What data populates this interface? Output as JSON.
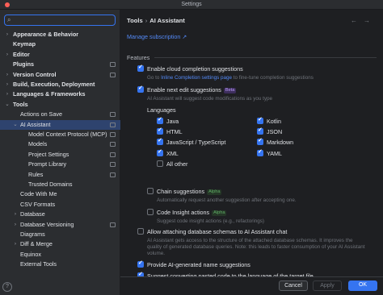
{
  "window": {
    "title": "Settings"
  },
  "sidebar": {
    "search_placeholder": "",
    "items": [
      {
        "label": "Appearance & Behavior",
        "chev": "›",
        "indent": 0,
        "bold": true
      },
      {
        "label": "Keymap",
        "chev": "",
        "indent": 0,
        "bold": true
      },
      {
        "label": "Editor",
        "chev": "›",
        "indent": 0,
        "bold": true
      },
      {
        "label": "Plugins",
        "chev": "",
        "indent": 0,
        "bold": true,
        "badge": true
      },
      {
        "label": "Version Control",
        "chev": "›",
        "indent": 0,
        "bold": true,
        "badge": true
      },
      {
        "label": "Build, Execution, Deployment",
        "chev": "›",
        "indent": 0,
        "bold": true
      },
      {
        "label": "Languages & Frameworks",
        "chev": "›",
        "indent": 0,
        "bold": true
      },
      {
        "label": "Tools",
        "chev": "⌄",
        "indent": 0,
        "bold": true
      },
      {
        "label": "Actions on Save",
        "chev": "",
        "indent": 1,
        "badge": true
      },
      {
        "label": "AI Assistant",
        "chev": "⌄",
        "indent": 1,
        "selected": true,
        "badge": true
      },
      {
        "label": "Model Context Protocol (MCP)",
        "chev": "",
        "indent": 2,
        "badge": true
      },
      {
        "label": "Models",
        "chev": "",
        "indent": 2,
        "badge": true
      },
      {
        "label": "Project Settings",
        "chev": "",
        "indent": 2,
        "badge": true
      },
      {
        "label": "Prompt Library",
        "chev": "",
        "indent": 2,
        "badge": true
      },
      {
        "label": "Rules",
        "chev": "",
        "indent": 2,
        "badge": true
      },
      {
        "label": "Trusted Domains",
        "chev": "",
        "indent": 2
      },
      {
        "label": "Code With Me",
        "chev": "",
        "indent": 1
      },
      {
        "label": "CSV Formats",
        "chev": "",
        "indent": 1
      },
      {
        "label": "Database",
        "chev": "›",
        "indent": 1
      },
      {
        "label": "Database Versioning",
        "chev": "›",
        "indent": 1,
        "badge": true
      },
      {
        "label": "Diagrams",
        "chev": "",
        "indent": 1
      },
      {
        "label": "Diff & Merge",
        "chev": "›",
        "indent": 1
      },
      {
        "label": "Equinox",
        "chev": "",
        "indent": 1
      },
      {
        "label": "External Tools",
        "chev": "",
        "indent": 1
      }
    ]
  },
  "breadcrumb": {
    "parent": "Tools",
    "sep": "›",
    "current": "AI Assistant"
  },
  "manage_link": "Manage subscription ↗",
  "features_section": "Features",
  "options": {
    "cloud_completion": {
      "label": "Enable cloud completion suggestions",
      "checked": true,
      "hint_prefix": "Go to ",
      "hint_link": "Inline Completion settings page",
      "hint_suffix": " to fine-tune completion suggestions"
    },
    "next_edit": {
      "label": "Enable next edit suggestions",
      "checked": true,
      "tag": "Beta",
      "hint": "AI Assistant will suggest code modifications as you type"
    },
    "languages_label": "Languages",
    "languages": [
      {
        "label": "Java",
        "checked": true
      },
      {
        "label": "Kotlin",
        "checked": true
      },
      {
        "label": "HTML",
        "checked": true
      },
      {
        "label": "JSON",
        "checked": true
      },
      {
        "label": "JavaScript / TypeScript",
        "checked": true
      },
      {
        "label": "Markdown",
        "checked": true
      },
      {
        "label": "XML",
        "checked": true
      },
      {
        "label": "YAML",
        "checked": true
      },
      {
        "label": "All other",
        "checked": false
      }
    ],
    "chain": {
      "label": "Chain suggestions",
      "checked": false,
      "tag": "Alpha",
      "hint": "Automatically request another suggestion after accepting one."
    },
    "code_insight": {
      "label": "Code Insight actions",
      "checked": false,
      "tag": "Alpha",
      "hint": "Suggest code insight actions (e.g., refactorings)"
    },
    "db_schemas": {
      "label": "Allow attaching database schemas to AI Assistant chat",
      "checked": false,
      "hint_lines": [
        "AI Assistant gets access to the structure of the attached database schemas. It improves the",
        "quality of generated database queries. Note: this leads to faster consumption of your AI Assistant",
        "volume."
      ]
    },
    "ai_names": {
      "label": "Provide AI-generated name suggestions",
      "checked": true
    },
    "convert_pasted": {
      "label": "Suggest converting pasted code to the language of the target file",
      "checked": true
    }
  },
  "footer": {
    "help": "?",
    "cancel": "Cancel",
    "apply": "Apply",
    "ok": "OK"
  },
  "colors": {
    "accent": "#3574f0",
    "selection": "#2e436e",
    "link": "#548af7",
    "background": "#1e1f22",
    "sidebar": "#2b2d30"
  }
}
